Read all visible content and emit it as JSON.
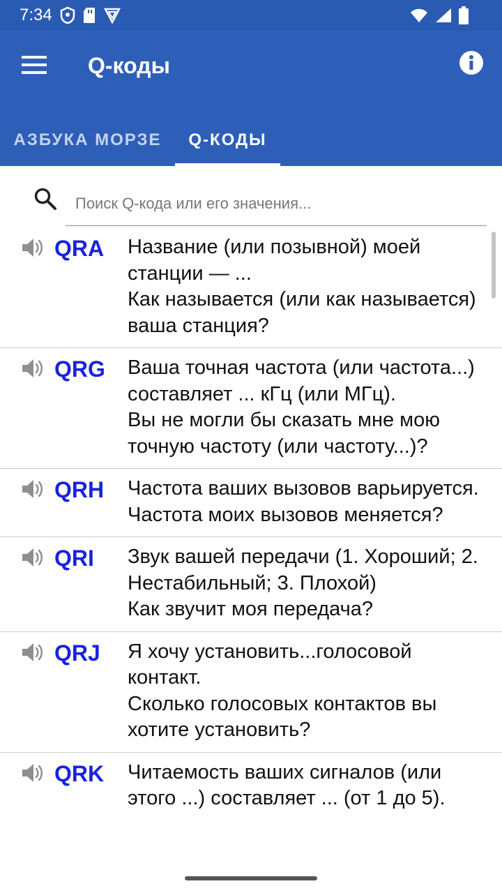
{
  "status_bar": {
    "time": "7:34",
    "icons": [
      "shield-icon",
      "sd-card-icon",
      "vpn-icon",
      "wifi-icon",
      "signal-icon",
      "battery-icon"
    ]
  },
  "app_bar": {
    "title": "Q-коды",
    "menu_icon": "menu-icon",
    "info_icon": "info-icon",
    "color": "#2e5fb8"
  },
  "tabs": [
    {
      "label": "АЗБУКА МОРЗЕ",
      "selected": false
    },
    {
      "label": "Q-КОДЫ",
      "selected": true
    }
  ],
  "search": {
    "placeholder": "Поиск Q-кода или его значения...",
    "value": ""
  },
  "codes": [
    {
      "code": "QRA",
      "meaning": "Название (или позывной) моей станции — ...\nКак называется (или как называется) ваша станция?"
    },
    {
      "code": "QRG",
      "meaning": "Ваша точная частота (или частота...) составляет ... кГц (или МГц).\nВы не могли бы сказать мне мою точную частоту (или частоту...)?"
    },
    {
      "code": "QRH",
      "meaning": "Частота ваших вызовов варьируется.\nЧастота моих вызовов меняется?"
    },
    {
      "code": "QRI",
      "meaning": "Звук вашей передачи (1. Хороший; 2. Нестабильный; 3. Плохой)\nКак звучит моя передача?"
    },
    {
      "code": "QRJ",
      "meaning": "Я хочу установить...голосовой контакт.\nСколько голосовых контактов вы хотите установить?"
    },
    {
      "code": "QRK",
      "meaning": "Читаемость ваших сигналов (или этого ...) составляет ... (от 1 до 5)."
    }
  ],
  "colors": {
    "code": "#1a22e0",
    "status_bar": "#2a5bb3"
  }
}
